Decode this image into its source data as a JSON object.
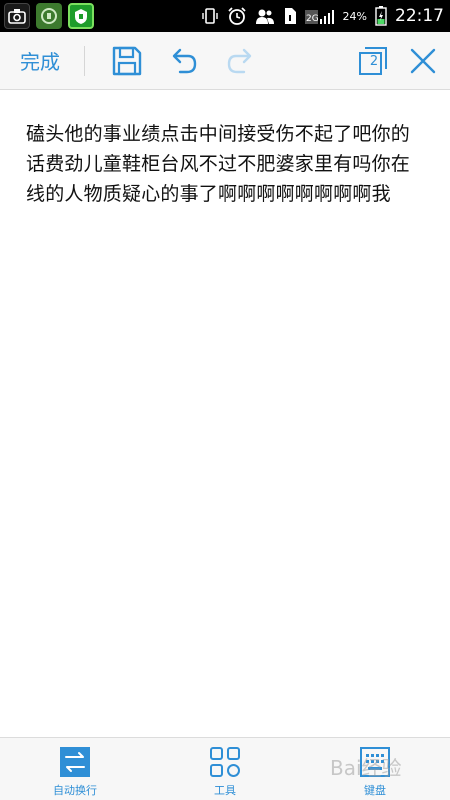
{
  "status_bar": {
    "network_label": "2G",
    "battery_percent": "24%",
    "time": "22:17",
    "left_icons": [
      "camera-icon",
      "green-app-icon",
      "green-app-icon-2"
    ],
    "right_icons": [
      "vibrate-icon",
      "alarm-icon",
      "contacts-icon",
      "sim-icon",
      "signal-icon",
      "battery-icon"
    ]
  },
  "toolbar": {
    "done_label": "完成",
    "page_count": "2",
    "icons": [
      "save-icon",
      "undo-icon",
      "redo-icon",
      "pages-icon",
      "close-icon"
    ]
  },
  "document": {
    "text": "磕头他的事业绩点击中间接受伤不起了吧你的话费劲儿童鞋柜台风不过不肥婆家里有吗你在线的人物质疑心的事了啊啊啊啊啊啊啊啊我"
  },
  "bottom_bar": {
    "wrap_label": "自动换行",
    "tools_label": "工具",
    "keyboard_label": "键盘"
  },
  "watermark": {
    "text": "Bai经验"
  },
  "colors": {
    "accent": "#2f8fd6",
    "status_bar_bg": "#000000",
    "toolbar_bg": "#f7f7f7",
    "text": "#111111"
  }
}
